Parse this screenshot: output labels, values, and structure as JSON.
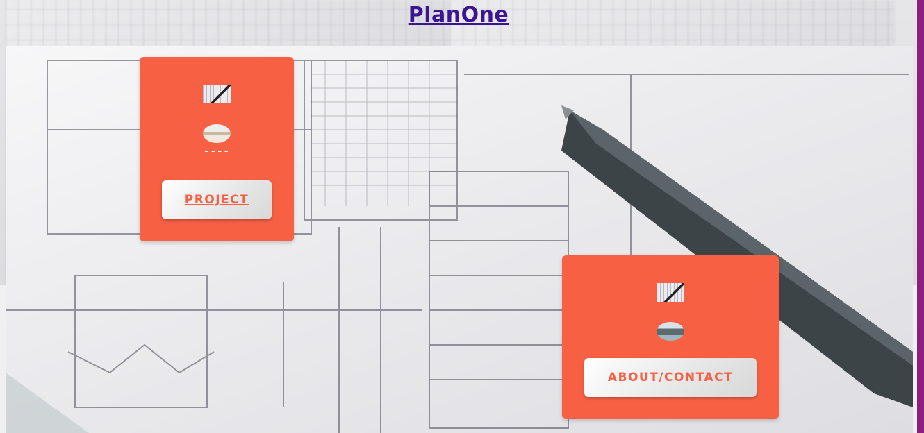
{
  "header": {
    "title": "PlanOne"
  },
  "cards": {
    "project": {
      "dash": "----",
      "button_label": "PROJECT"
    },
    "about": {
      "button_label": "ABOUT/CONTACT"
    }
  },
  "colors": {
    "card": "#f86044",
    "title": "#3a1690",
    "accent_edge": "#8e1f7e"
  },
  "icons": {
    "project_thumb": "blueprint-thumbnail-icon",
    "project_avatar": "interior-photo-icon",
    "about_thumb": "blueprint-thumbnail-icon",
    "about_avatar": "team-photo-icon"
  }
}
